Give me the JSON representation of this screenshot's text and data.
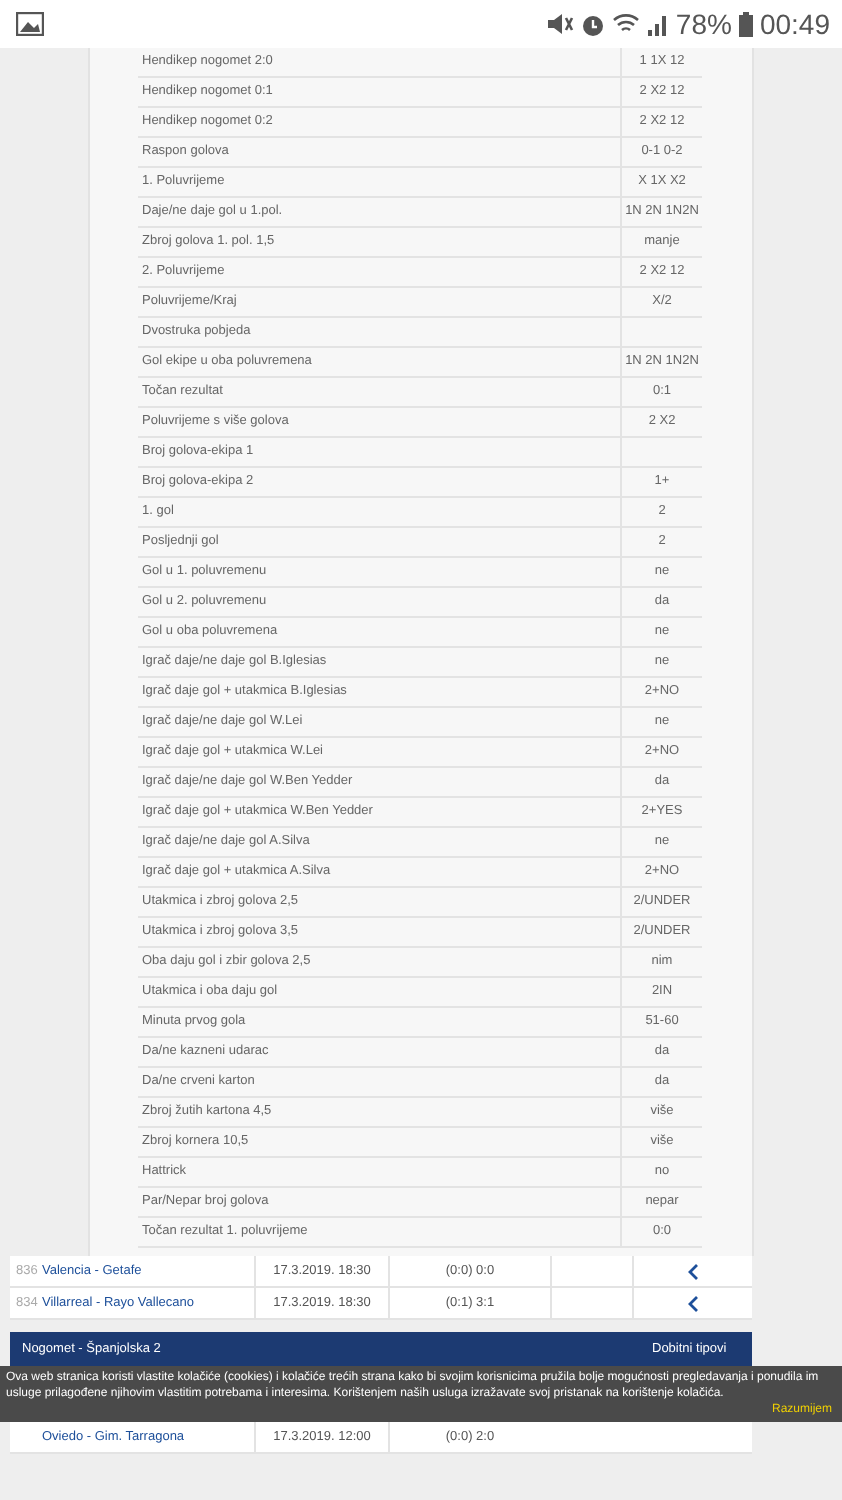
{
  "status_bar": {
    "battery": "78%",
    "time": "00:49"
  },
  "markets": [
    {
      "label": "Hendikep nogomet 2:0",
      "value": "1 1X 12"
    },
    {
      "label": "Hendikep nogomet 0:1",
      "value": "2 X2 12"
    },
    {
      "label": "Hendikep nogomet 0:2",
      "value": "2 X2 12"
    },
    {
      "label": "Raspon golova",
      "value": "0-1 0-2"
    },
    {
      "label": "1. Poluvrijeme",
      "value": "X 1X X2"
    },
    {
      "label": "Daje/ne daje gol u 1.pol.",
      "value": "1N 2N 1N2N"
    },
    {
      "label": "Zbroj golova 1. pol. 1,5",
      "value": "manje"
    },
    {
      "label": "2. Poluvrijeme",
      "value": "2 X2 12"
    },
    {
      "label": "Poluvrijeme/Kraj",
      "value": "X/2"
    },
    {
      "label": "Dvostruka pobjeda"
    },
    {
      "label": "Gol ekipe u oba poluvremena",
      "value": "1N 2N 1N2N"
    },
    {
      "label": "Točan rezultat",
      "value": "0:1"
    },
    {
      "label": "Poluvrijeme s više golova",
      "value": "2 X2"
    },
    {
      "label": "Broj golova-ekipa 1"
    },
    {
      "label": "Broj golova-ekipa 2",
      "value": "1+"
    },
    {
      "label": "1. gol",
      "value": "2"
    },
    {
      "label": "Posljednji gol",
      "value": "2"
    },
    {
      "label": "Gol u 1. poluvremenu",
      "value": "ne"
    },
    {
      "label": "Gol u 2. poluvremenu",
      "value": "da"
    },
    {
      "label": "Gol u oba poluvremena",
      "value": "ne"
    },
    {
      "label": "Igrač daje/ne daje gol B.Iglesias",
      "value": "ne"
    },
    {
      "label": "Igrač daje gol + utakmica B.Iglesias",
      "value": "2+NO"
    },
    {
      "label": "Igrač daje/ne daje gol W.Lei",
      "value": "ne"
    },
    {
      "label": "Igrač daje gol + utakmica W.Lei",
      "value": "2+NO"
    },
    {
      "label": "Igrač daje/ne daje gol W.Ben Yedder",
      "value": "da"
    },
    {
      "label": "Igrač daje gol + utakmica W.Ben Yedder",
      "value": "2+YES"
    },
    {
      "label": "Igrač daje/ne daje gol A.Silva",
      "value": "ne"
    },
    {
      "label": "Igrač daje gol + utakmica A.Silva",
      "value": "2+NO"
    },
    {
      "label": "Utakmica i zbroj golova 2,5",
      "value": "2/UNDER"
    },
    {
      "label": "Utakmica i zbroj golova 3,5",
      "value": "2/UNDER"
    },
    {
      "label": "Oba daju gol i zbir golova 2,5",
      "value": "nim"
    },
    {
      "label": "Utakmica i oba daju gol",
      "value": "2IN"
    },
    {
      "label": "Minuta prvog gola",
      "value": "51-60"
    },
    {
      "label": "Da/ne kazneni udarac",
      "value": "da"
    },
    {
      "label": "Da/ne crveni karton",
      "value": "da"
    },
    {
      "label": "Zbroj žutih kartona 4,5",
      "value": "više"
    },
    {
      "label": "Zbroj kornera 10,5",
      "value": "više"
    },
    {
      "label": "Hattrick",
      "value": "no"
    },
    {
      "label": "Par/Nepar broj golova",
      "value": "nepar"
    },
    {
      "label": "Točan rezultat 1. poluvrijeme",
      "value": "0:0"
    }
  ],
  "matches": [
    {
      "id": "836",
      "teams": "Valencia - Getafe",
      "date": "17.3.2019. 18:30",
      "score": "(0:0) 0:0"
    },
    {
      "id": "834",
      "teams": "Villarreal - Rayo Vallecano",
      "date": "17.3.2019. 18:30",
      "score": "(0:1) 3:1"
    }
  ],
  "league": {
    "title": "Nogomet - Španjolska 2",
    "column": "Dobitni tipovi"
  },
  "cookie_banner": {
    "text": "Ova web stranica koristi vlastite kolačiće (cookies) i kolačiće trećih strana kako bi svojim korisnicima pružila bolje mogućnosti pregledavanja i ponudila im usluge prilagođene njihovim vlastitim potrebama i interesima. Korištenjem naših usluga izražavate svoj pristanak na korištenje kolačića.",
    "button": "Razumijem"
  },
  "league_matches": [
    {
      "teams": "Oviedo - Gim. Tarragona",
      "date": "17.3.2019. 12:00",
      "score": "(0:0) 2:0"
    }
  ]
}
